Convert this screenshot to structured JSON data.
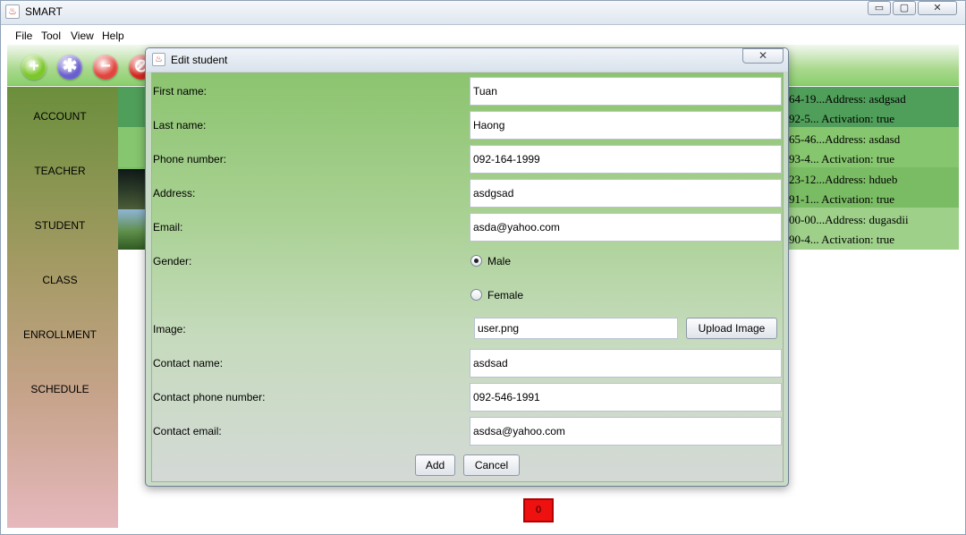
{
  "window": {
    "title": "SMART",
    "controls": {
      "minimize": "▭",
      "maximize": "▢",
      "close": "✕"
    }
  },
  "menu": [
    "File",
    "Tool",
    "View",
    "Help"
  ],
  "toolbar": {
    "buttons": [
      {
        "name": "add",
        "icon": "plus-icon",
        "glyph": "+",
        "color": "#7cc72a"
      },
      {
        "name": "settings",
        "icon": "gear-icon",
        "glyph": "✱",
        "color": "#6a5fcf"
      },
      {
        "name": "remove",
        "icon": "minus-icon",
        "glyph": "−",
        "color": "#e0453e"
      },
      {
        "name": "block",
        "icon": "block-icon",
        "glyph": "⊘",
        "color": "#d6281e"
      }
    ]
  },
  "sidebar": {
    "items": [
      "ACCOUNT",
      "TEACHER",
      "STUDENT",
      "CLASS",
      "ENROLLMENT",
      "SCHEDULE"
    ]
  },
  "list": {
    "lines": [
      "64-19...Address: asdgsad",
      "92-5... Activation: true",
      "65-46...Address: asdasd",
      "93-4... Activation: true",
      "23-12...Address: hdueb",
      "91-1... Activation: true",
      "00-00...Address: dugasdii",
      "90-4... Activation: true"
    ]
  },
  "counter": "0",
  "dialog": {
    "title": "Edit student",
    "close_glyph": "✕",
    "labels": {
      "first_name": "First name:",
      "last_name": "Last name:",
      "phone": "Phone number:",
      "address": "Address:",
      "email": "Email:",
      "gender": "Gender:",
      "image": "Image:",
      "contact_name": "Contact name:",
      "contact_phone": "Contact phone number:",
      "contact_email": "Contact email:"
    },
    "values": {
      "first_name": "Tuan",
      "last_name": "Haong",
      "phone": "092-164-1999",
      "address": "asdgsad",
      "email": "asda@yahoo.com",
      "image": "user.png",
      "contact_name": "asdsad",
      "contact_phone": "092-546-1991",
      "contact_email": "asdsa@yahoo.com"
    },
    "gender": {
      "male": "Male",
      "female": "Female",
      "selected": "Male"
    },
    "buttons": {
      "upload": "Upload Image",
      "add": "Add",
      "cancel": "Cancel"
    }
  }
}
